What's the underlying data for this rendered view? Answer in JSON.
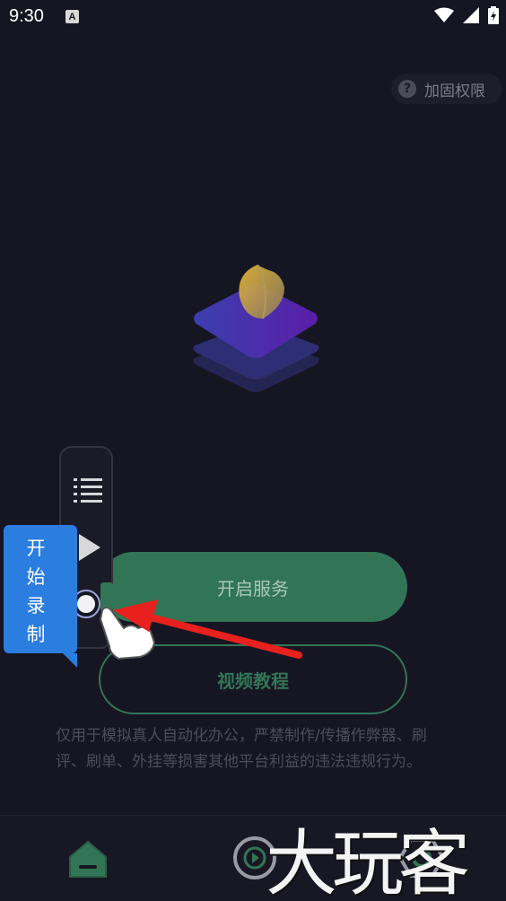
{
  "status_bar": {
    "time": "9:30",
    "notification_icon": "A"
  },
  "header": {
    "permission_button": "加固权限",
    "help_icon": "?"
  },
  "logo": {
    "name": "app-logo-icon"
  },
  "main": {
    "start_service_button": "开启服务",
    "tutorial_button": "视频教程",
    "disclaimer": "仅用于模拟真人自动化办公，严禁制作/传播作弊器、刷评、刷单、外挂等损害其他平台利益的违法违规行为。"
  },
  "float_toolbar": {
    "tooltip": "开始录制",
    "icons": [
      "list-icon",
      "play-icon",
      "record-icon"
    ]
  },
  "bottom_nav": {
    "items": [
      "home-icon",
      "play-circle-icon",
      "settings-icon"
    ]
  },
  "watermark": "大玩客",
  "colors": {
    "background": "#161622",
    "accent_green": "#327556",
    "tooltip_blue": "#2b7de0",
    "arrow_red": "#e8201e"
  }
}
